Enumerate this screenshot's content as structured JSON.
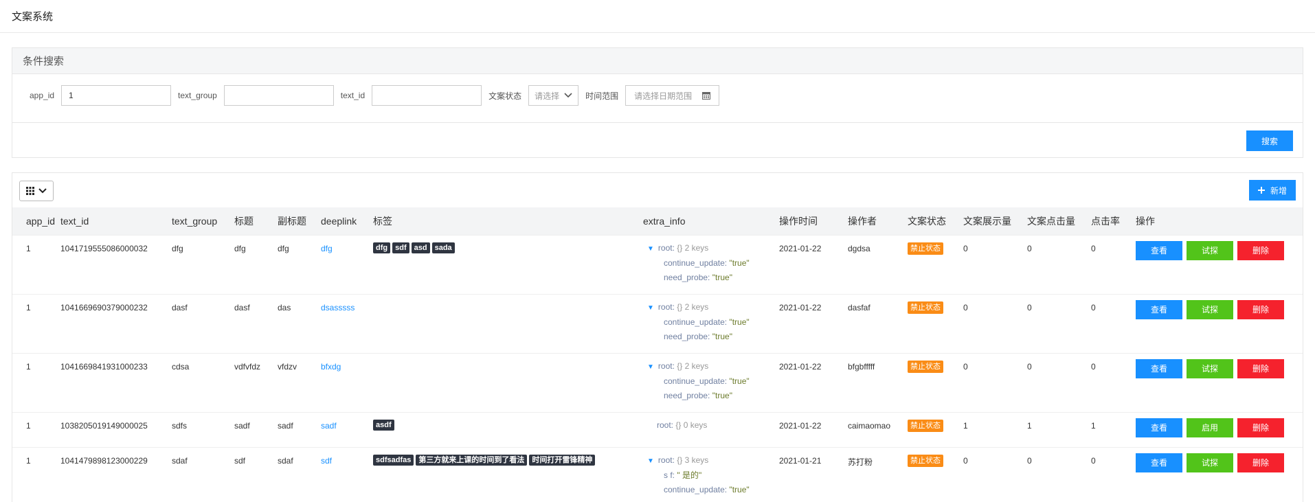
{
  "app": {
    "title": "文案系统"
  },
  "search": {
    "panel_title": "条件搜索",
    "app_id_label": "app_id",
    "app_id_value": "1",
    "text_group_label": "text_group",
    "text_group_value": "",
    "text_id_label": "text_id",
    "text_id_value": "",
    "status_label": "文案状态",
    "status_placeholder": "请选择",
    "time_label": "时间范围",
    "time_placeholder": "请选择日期范围",
    "search_button": "搜索"
  },
  "toolbar": {
    "add_button": "新增"
  },
  "table": {
    "columns": [
      "app_id",
      "text_id",
      "text_group",
      "标题",
      "副标题",
      "deeplink",
      "标签",
      "extra_info",
      "操作时间",
      "操作者",
      "文案状态",
      "文案展示量",
      "文案点击量",
      "点击率",
      "操作"
    ],
    "rows": [
      {
        "app_id": "1",
        "text_id": "1041719555086000032",
        "text_group": "dfg",
        "title": "dfg",
        "subtitle": "dfg",
        "deeplink": "dfg",
        "tags": [
          "dfg",
          "sdf",
          "asd",
          "sada"
        ],
        "extra": {
          "root": "root:",
          "summary": "{}  2 keys",
          "expand": true,
          "items": [
            {
              "k": "continue_update:",
              "v": "\"true\""
            },
            {
              "k": "need_probe:",
              "v": "\"true\""
            }
          ]
        },
        "time": "2021-01-22",
        "operator": "dgdsa",
        "status": "禁止状态",
        "views": "0",
        "clicks": "0",
        "ctr": "0",
        "ops": [
          "查看",
          "试探",
          "删除"
        ]
      },
      {
        "app_id": "1",
        "text_id": "1041669690379000232",
        "text_group": "dasf",
        "title": "dasf",
        "subtitle": "das",
        "deeplink": "dsasssss",
        "tags": [],
        "extra": {
          "root": "root:",
          "summary": "{}  2 keys",
          "expand": true,
          "items": [
            {
              "k": "continue_update:",
              "v": "\"true\""
            },
            {
              "k": "need_probe:",
              "v": "\"true\""
            }
          ]
        },
        "time": "2021-01-22",
        "operator": "dasfaf",
        "status": "禁止状态",
        "views": "0",
        "clicks": "0",
        "ctr": "0",
        "ops": [
          "查看",
          "试探",
          "删除"
        ]
      },
      {
        "app_id": "1",
        "text_id": "1041669841931000233",
        "text_group": "cdsa",
        "title": "vdfvfdz",
        "subtitle": "vfdzv",
        "deeplink": "bfxdg",
        "tags": [],
        "extra": {
          "root": "root:",
          "summary": "{}  2 keys",
          "expand": true,
          "items": [
            {
              "k": "continue_update:",
              "v": "\"true\""
            },
            {
              "k": "need_probe:",
              "v": "\"true\""
            }
          ]
        },
        "time": "2021-01-22",
        "operator": "bfgbfffff",
        "status": "禁止状态",
        "views": "0",
        "clicks": "0",
        "ctr": "0",
        "ops": [
          "查看",
          "试探",
          "删除"
        ]
      },
      {
        "app_id": "1",
        "text_id": "1038205019149000025",
        "text_group": "sdfs",
        "title": "sadf",
        "subtitle": "sadf",
        "deeplink": "sadf",
        "tags": [
          "asdf"
        ],
        "extra": {
          "root": "root:",
          "summary": "{}  0 keys",
          "expand": false,
          "items": []
        },
        "time": "2021-01-22",
        "operator": "caimaomao",
        "status": "禁止状态",
        "views": "1",
        "clicks": "1",
        "ctr": "1",
        "ops": [
          "查看",
          "启用",
          "删除"
        ]
      },
      {
        "app_id": "1",
        "text_id": "1041479898123000229",
        "text_group": "sdaf",
        "title": "sdf",
        "subtitle": "sdaf",
        "deeplink": "sdf",
        "tags": [
          "sdfsadfas",
          "第三方就来上课的时间到了看法",
          "时间打开雷锋精神"
        ],
        "extra": {
          "root": "root:",
          "summary": "{}  3 keys",
          "expand": true,
          "items": [
            {
              "k": "s f:",
              "v": "\" 是的\""
            },
            {
              "k": "continue_update:",
              "v": "\"true\""
            }
          ]
        },
        "time": "2021-01-21",
        "operator": "苏打粉",
        "status": "禁止状态",
        "views": "0",
        "clicks": "0",
        "ctr": "0",
        "ops": [
          "查看",
          "试探",
          "删除"
        ]
      }
    ]
  },
  "colors": {
    "primary": "#1890ff",
    "success": "#52c41a",
    "danger": "#f5222d",
    "warning": "#fa8c16",
    "tag": "#2f3541"
  }
}
